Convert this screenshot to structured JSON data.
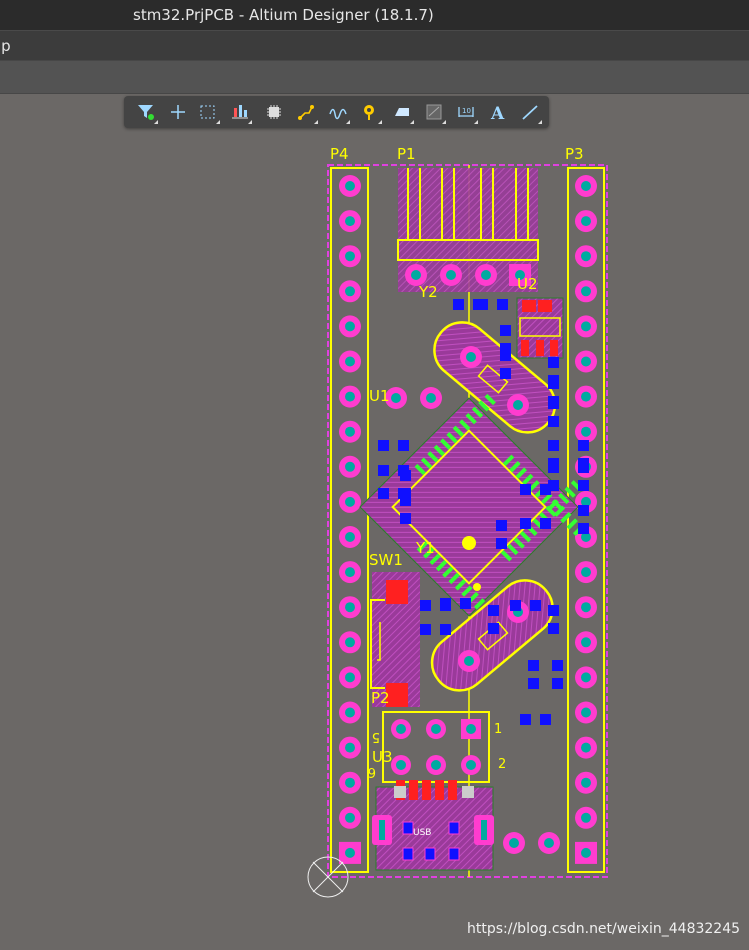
{
  "window": {
    "title": "stm32.PrjPCB - Altium Designer (18.1.7)"
  },
  "menubar": {
    "partial_item": "lp"
  },
  "toolbar": {
    "tools": [
      {
        "name": "filter-icon"
      },
      {
        "name": "crosshair-icon"
      },
      {
        "name": "select-rect-icon"
      },
      {
        "name": "align-icon"
      },
      {
        "name": "component-icon"
      },
      {
        "name": "route-icon"
      },
      {
        "name": "diff-pair-icon"
      },
      {
        "name": "via-icon"
      },
      {
        "name": "polygon-icon"
      },
      {
        "name": "region-icon"
      },
      {
        "name": "dimension-icon"
      },
      {
        "name": "text-icon"
      },
      {
        "name": "line-icon"
      }
    ]
  },
  "pcb": {
    "designators": {
      "p4": "P4",
      "p1": "P1",
      "p3": "P3",
      "y2": "Y2",
      "u2": "U2",
      "u1": "U1",
      "sw1": "SW1",
      "y1": "Y1",
      "p2": "P2",
      "u3": "U3",
      "usb": "USB",
      "pin_1": "1",
      "pin_2": "2",
      "pin_5": "5",
      "pin_6": "6"
    },
    "colors": {
      "background": "#6b6866",
      "board_outline": "#e040e0",
      "silkscreen": "#ffff00",
      "pad_copper": "#ff3ccf",
      "smd_pad": "#1010ff",
      "via_hole": "#00aaa0",
      "qfp_pads": "#33ff33",
      "red_pads": "#ff2020"
    }
  },
  "watermark": "https://blog.csdn.net/weixin_44832245"
}
